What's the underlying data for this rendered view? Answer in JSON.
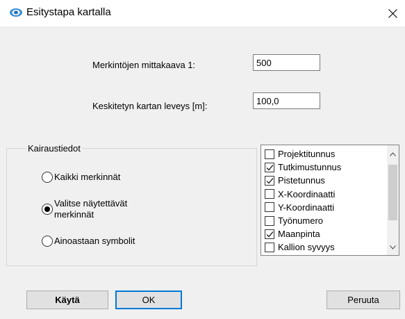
{
  "window": {
    "title": "Esitystapa kartalla",
    "icon": "app-map-icon",
    "close_icon": "close-icon"
  },
  "fields": {
    "scale_label": "Merkintöjen mittakaava 1:",
    "scale_value": "500",
    "width_label": "Keskitetyn kartan leveys [m]:",
    "width_value": "100,0"
  },
  "drilling": {
    "legend": "Kairaustiedot",
    "options": [
      {
        "label": "Kaikki merkinnät",
        "checked": false
      },
      {
        "label": "Valitse näytettävät\nmerkinnät",
        "checked": true
      },
      {
        "label": "Ainoastaan symbolit",
        "checked": false
      }
    ]
  },
  "listbox": {
    "items": [
      {
        "label": "Projektitunnus",
        "checked": false
      },
      {
        "label": "Tutkimustunnus",
        "checked": true
      },
      {
        "label": "Pistetunnus",
        "checked": true
      },
      {
        "label": "X-Koordinaatti",
        "checked": false
      },
      {
        "label": "Y-Koordinaatti",
        "checked": false
      },
      {
        "label": "Työnumero",
        "checked": false
      },
      {
        "label": "Maanpinta",
        "checked": true
      },
      {
        "label": "Kallion syvyys",
        "checked": false
      }
    ],
    "scroll_up_icon": "chevron-up-icon",
    "scroll_down_icon": "chevron-down-icon"
  },
  "buttons": {
    "apply": "Käytä",
    "ok": "OK",
    "cancel": "Peruuta"
  },
  "colors": {
    "accent": "#0078d7",
    "icon_blue": "#3b8fd6"
  }
}
